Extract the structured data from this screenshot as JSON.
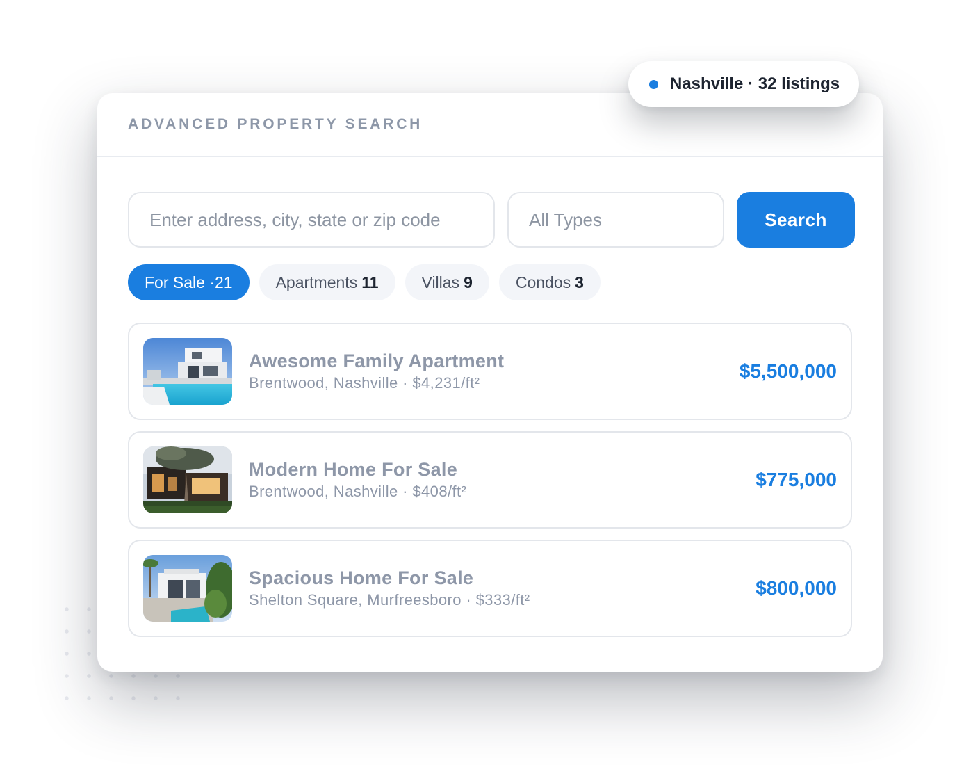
{
  "badge": {
    "text": "Nashville · 32 listings",
    "dot_color": "#1a7ee0"
  },
  "panel": {
    "title": "ADVANCED PROPERTY SEARCH"
  },
  "search": {
    "address_placeholder": "Enter address, city, state or zip code",
    "type_value": "All Types",
    "button_label": "Search"
  },
  "filters": [
    {
      "label": "For Sale · ",
      "count": "21",
      "active": true
    },
    {
      "label": "Apartments",
      "count": "11",
      "active": false
    },
    {
      "label": "Villas",
      "count": "9",
      "active": false
    },
    {
      "label": "Condos",
      "count": "3",
      "active": false
    }
  ],
  "listings": [
    {
      "title": "Awesome Family Apartment",
      "subtitle": "Brentwood, Nashville · $4,231/ft²",
      "price": "$5,500,000",
      "image": "white-villa-with-pool"
    },
    {
      "title": "Modern Home For Sale",
      "subtitle": "Brentwood, Nashville · $408/ft²",
      "price": "$775,000",
      "image": "modern-dark-house-at-dusk"
    },
    {
      "title": "Spacious Home For Sale",
      "subtitle": "Shelton Square, Murfreesboro · $333/ft²",
      "price": "$800,000",
      "image": "white-house-with-pool-and-palms"
    }
  ],
  "colors": {
    "accent": "#1a7ee0",
    "muted_text": "#8e97a8",
    "chip_bg": "#f3f5f9"
  }
}
